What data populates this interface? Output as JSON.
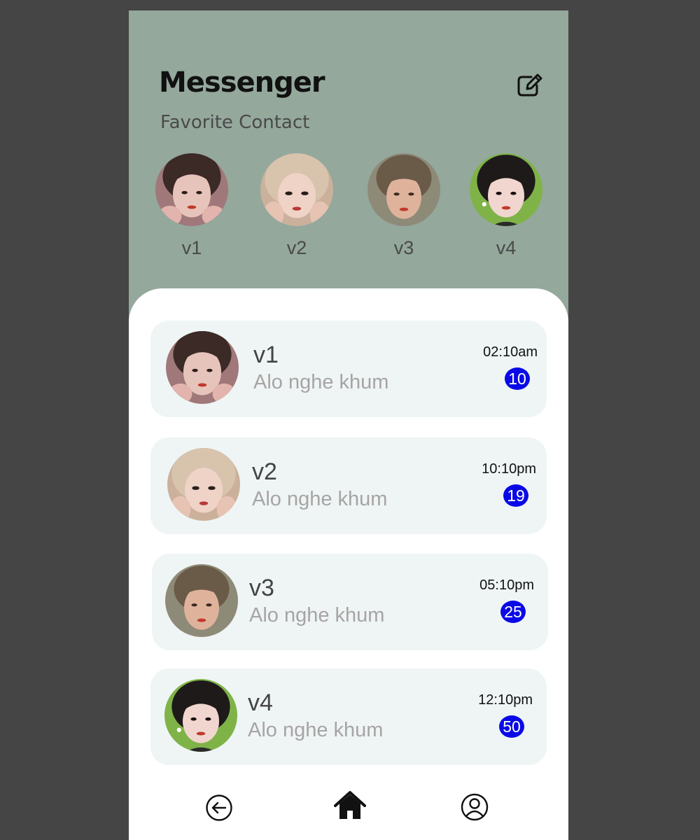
{
  "header": {
    "title": "Messenger",
    "subtitle": "Favorite Contact",
    "edit_icon": "edit-square-icon"
  },
  "favorites": [
    {
      "label": "v1"
    },
    {
      "label": "v2"
    },
    {
      "label": "v3"
    },
    {
      "label": "v4"
    }
  ],
  "chats": [
    {
      "name": "v1",
      "message": "Alo nghe khum",
      "time": "02:10am",
      "unread": "10"
    },
    {
      "name": "v2",
      "message": "Alo nghe khum",
      "time": "10:10pm",
      "unread": "19"
    },
    {
      "name": "v3",
      "message": "Alo nghe khum",
      "time": "05:10pm",
      "unread": "25"
    },
    {
      "name": "v4",
      "message": "Alo nghe khum",
      "time": "12:10pm",
      "unread": "50"
    }
  ],
  "bottom_nav": {
    "items": [
      "back-arrow-icon",
      "home-icon",
      "profile-icon"
    ]
  },
  "colors": {
    "header_bg": "#94a89c",
    "sheet_bg": "#ffffff",
    "card_bg": "#eff5f5",
    "badge_bg": "#0a0ae6",
    "outer_bg": "#454545"
  }
}
